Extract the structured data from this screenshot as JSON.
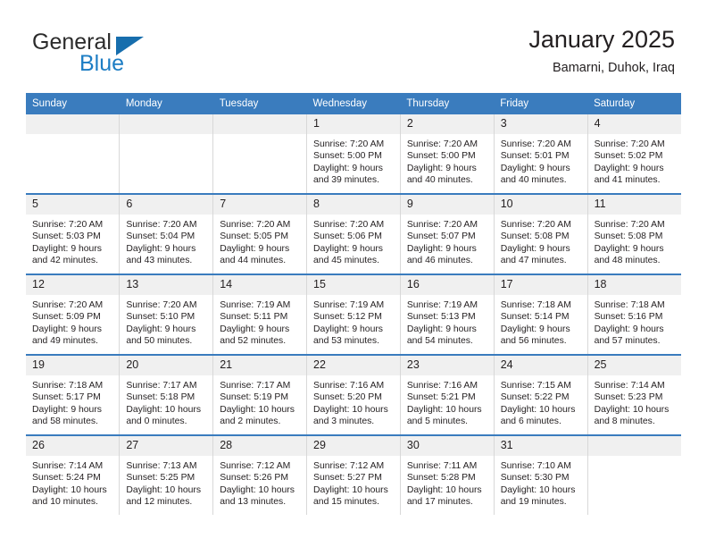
{
  "logo": {
    "word_one": "General",
    "word_two": "Blue",
    "triangle_color": "#176ead",
    "blue_color": "#1d7dc4"
  },
  "header": {
    "title": "January 2025",
    "subtitle": "Bamarni, Duhok, Iraq"
  },
  "theme": {
    "header_blue": "#3a7cbe",
    "daynum_gray": "#f0f0f0",
    "divider_gray": "#d8d8d8",
    "text": "#231f20"
  },
  "weekdays": [
    "Sunday",
    "Monday",
    "Tuesday",
    "Wednesday",
    "Thursday",
    "Friday",
    "Saturday"
  ],
  "weeks": [
    [
      {
        "day": "",
        "sunrise": "",
        "sunset": "",
        "daylight1": "",
        "daylight2": ""
      },
      {
        "day": "",
        "sunrise": "",
        "sunset": "",
        "daylight1": "",
        "daylight2": ""
      },
      {
        "day": "",
        "sunrise": "",
        "sunset": "",
        "daylight1": "",
        "daylight2": ""
      },
      {
        "day": "1",
        "sunrise": "Sunrise: 7:20 AM",
        "sunset": "Sunset: 5:00 PM",
        "daylight1": "Daylight: 9 hours",
        "daylight2": "and 39 minutes."
      },
      {
        "day": "2",
        "sunrise": "Sunrise: 7:20 AM",
        "sunset": "Sunset: 5:00 PM",
        "daylight1": "Daylight: 9 hours",
        "daylight2": "and 40 minutes."
      },
      {
        "day": "3",
        "sunrise": "Sunrise: 7:20 AM",
        "sunset": "Sunset: 5:01 PM",
        "daylight1": "Daylight: 9 hours",
        "daylight2": "and 40 minutes."
      },
      {
        "day": "4",
        "sunrise": "Sunrise: 7:20 AM",
        "sunset": "Sunset: 5:02 PM",
        "daylight1": "Daylight: 9 hours",
        "daylight2": "and 41 minutes."
      }
    ],
    [
      {
        "day": "5",
        "sunrise": "Sunrise: 7:20 AM",
        "sunset": "Sunset: 5:03 PM",
        "daylight1": "Daylight: 9 hours",
        "daylight2": "and 42 minutes."
      },
      {
        "day": "6",
        "sunrise": "Sunrise: 7:20 AM",
        "sunset": "Sunset: 5:04 PM",
        "daylight1": "Daylight: 9 hours",
        "daylight2": "and 43 minutes."
      },
      {
        "day": "7",
        "sunrise": "Sunrise: 7:20 AM",
        "sunset": "Sunset: 5:05 PM",
        "daylight1": "Daylight: 9 hours",
        "daylight2": "and 44 minutes."
      },
      {
        "day": "8",
        "sunrise": "Sunrise: 7:20 AM",
        "sunset": "Sunset: 5:06 PM",
        "daylight1": "Daylight: 9 hours",
        "daylight2": "and 45 minutes."
      },
      {
        "day": "9",
        "sunrise": "Sunrise: 7:20 AM",
        "sunset": "Sunset: 5:07 PM",
        "daylight1": "Daylight: 9 hours",
        "daylight2": "and 46 minutes."
      },
      {
        "day": "10",
        "sunrise": "Sunrise: 7:20 AM",
        "sunset": "Sunset: 5:08 PM",
        "daylight1": "Daylight: 9 hours",
        "daylight2": "and 47 minutes."
      },
      {
        "day": "11",
        "sunrise": "Sunrise: 7:20 AM",
        "sunset": "Sunset: 5:08 PM",
        "daylight1": "Daylight: 9 hours",
        "daylight2": "and 48 minutes."
      }
    ],
    [
      {
        "day": "12",
        "sunrise": "Sunrise: 7:20 AM",
        "sunset": "Sunset: 5:09 PM",
        "daylight1": "Daylight: 9 hours",
        "daylight2": "and 49 minutes."
      },
      {
        "day": "13",
        "sunrise": "Sunrise: 7:20 AM",
        "sunset": "Sunset: 5:10 PM",
        "daylight1": "Daylight: 9 hours",
        "daylight2": "and 50 minutes."
      },
      {
        "day": "14",
        "sunrise": "Sunrise: 7:19 AM",
        "sunset": "Sunset: 5:11 PM",
        "daylight1": "Daylight: 9 hours",
        "daylight2": "and 52 minutes."
      },
      {
        "day": "15",
        "sunrise": "Sunrise: 7:19 AM",
        "sunset": "Sunset: 5:12 PM",
        "daylight1": "Daylight: 9 hours",
        "daylight2": "and 53 minutes."
      },
      {
        "day": "16",
        "sunrise": "Sunrise: 7:19 AM",
        "sunset": "Sunset: 5:13 PM",
        "daylight1": "Daylight: 9 hours",
        "daylight2": "and 54 minutes."
      },
      {
        "day": "17",
        "sunrise": "Sunrise: 7:18 AM",
        "sunset": "Sunset: 5:14 PM",
        "daylight1": "Daylight: 9 hours",
        "daylight2": "and 56 minutes."
      },
      {
        "day": "18",
        "sunrise": "Sunrise: 7:18 AM",
        "sunset": "Sunset: 5:16 PM",
        "daylight1": "Daylight: 9 hours",
        "daylight2": "and 57 minutes."
      }
    ],
    [
      {
        "day": "19",
        "sunrise": "Sunrise: 7:18 AM",
        "sunset": "Sunset: 5:17 PM",
        "daylight1": "Daylight: 9 hours",
        "daylight2": "and 58 minutes."
      },
      {
        "day": "20",
        "sunrise": "Sunrise: 7:17 AM",
        "sunset": "Sunset: 5:18 PM",
        "daylight1": "Daylight: 10 hours",
        "daylight2": "and 0 minutes."
      },
      {
        "day": "21",
        "sunrise": "Sunrise: 7:17 AM",
        "sunset": "Sunset: 5:19 PM",
        "daylight1": "Daylight: 10 hours",
        "daylight2": "and 2 minutes."
      },
      {
        "day": "22",
        "sunrise": "Sunrise: 7:16 AM",
        "sunset": "Sunset: 5:20 PM",
        "daylight1": "Daylight: 10 hours",
        "daylight2": "and 3 minutes."
      },
      {
        "day": "23",
        "sunrise": "Sunrise: 7:16 AM",
        "sunset": "Sunset: 5:21 PM",
        "daylight1": "Daylight: 10 hours",
        "daylight2": "and 5 minutes."
      },
      {
        "day": "24",
        "sunrise": "Sunrise: 7:15 AM",
        "sunset": "Sunset: 5:22 PM",
        "daylight1": "Daylight: 10 hours",
        "daylight2": "and 6 minutes."
      },
      {
        "day": "25",
        "sunrise": "Sunrise: 7:14 AM",
        "sunset": "Sunset: 5:23 PM",
        "daylight1": "Daylight: 10 hours",
        "daylight2": "and 8 minutes."
      }
    ],
    [
      {
        "day": "26",
        "sunrise": "Sunrise: 7:14 AM",
        "sunset": "Sunset: 5:24 PM",
        "daylight1": "Daylight: 10 hours",
        "daylight2": "and 10 minutes."
      },
      {
        "day": "27",
        "sunrise": "Sunrise: 7:13 AM",
        "sunset": "Sunset: 5:25 PM",
        "daylight1": "Daylight: 10 hours",
        "daylight2": "and 12 minutes."
      },
      {
        "day": "28",
        "sunrise": "Sunrise: 7:12 AM",
        "sunset": "Sunset: 5:26 PM",
        "daylight1": "Daylight: 10 hours",
        "daylight2": "and 13 minutes."
      },
      {
        "day": "29",
        "sunrise": "Sunrise: 7:12 AM",
        "sunset": "Sunset: 5:27 PM",
        "daylight1": "Daylight: 10 hours",
        "daylight2": "and 15 minutes."
      },
      {
        "day": "30",
        "sunrise": "Sunrise: 7:11 AM",
        "sunset": "Sunset: 5:28 PM",
        "daylight1": "Daylight: 10 hours",
        "daylight2": "and 17 minutes."
      },
      {
        "day": "31",
        "sunrise": "Sunrise: 7:10 AM",
        "sunset": "Sunset: 5:30 PM",
        "daylight1": "Daylight: 10 hours",
        "daylight2": "and 19 minutes."
      },
      {
        "day": "",
        "sunrise": "",
        "sunset": "",
        "daylight1": "",
        "daylight2": ""
      }
    ]
  ]
}
